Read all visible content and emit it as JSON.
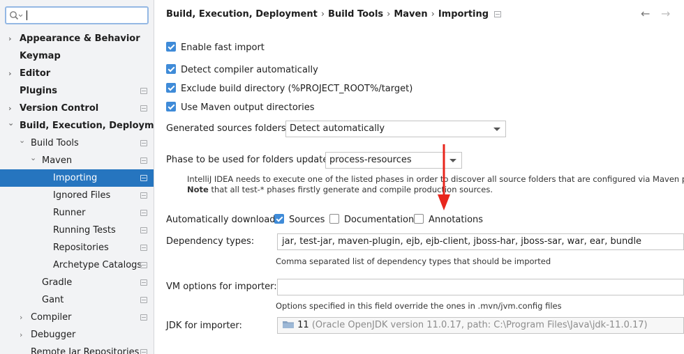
{
  "sidebar": {
    "items": [
      {
        "label": "Appearance & Behavior",
        "arrow": "collapsed",
        "bold": true,
        "project": false
      },
      {
        "label": "Keymap",
        "arrow": "none",
        "bold": true,
        "project": false
      },
      {
        "label": "Editor",
        "arrow": "collapsed",
        "bold": true,
        "project": false
      },
      {
        "label": "Plugins",
        "arrow": "none",
        "bold": true,
        "project": true
      },
      {
        "label": "Version Control",
        "arrow": "collapsed",
        "bold": true,
        "project": true
      },
      {
        "label": "Build, Execution, Deployment",
        "arrow": "expanded",
        "bold": true,
        "project": false
      },
      {
        "label": "Build Tools",
        "arrow": "expanded",
        "bold": false,
        "project": true
      },
      {
        "label": "Maven",
        "arrow": "expanded",
        "bold": false,
        "project": true
      },
      {
        "label": "Importing",
        "arrow": "none",
        "bold": false,
        "project": true,
        "selected": true
      },
      {
        "label": "Ignored Files",
        "arrow": "none",
        "bold": false,
        "project": true
      },
      {
        "label": "Runner",
        "arrow": "none",
        "bold": false,
        "project": true
      },
      {
        "label": "Running Tests",
        "arrow": "none",
        "bold": false,
        "project": true
      },
      {
        "label": "Repositories",
        "arrow": "none",
        "bold": false,
        "project": true
      },
      {
        "label": "Archetype Catalogs",
        "arrow": "none",
        "bold": false,
        "project": true
      },
      {
        "label": "Gradle",
        "arrow": "none",
        "bold": false,
        "project": true
      },
      {
        "label": "Gant",
        "arrow": "none",
        "bold": false,
        "project": true
      },
      {
        "label": "Compiler",
        "arrow": "collapsed",
        "bold": false,
        "project": true
      },
      {
        "label": "Debugger",
        "arrow": "collapsed",
        "bold": false,
        "project": false
      },
      {
        "label": "Remote Jar Repositories",
        "arrow": "none",
        "bold": false,
        "project": true
      }
    ]
  },
  "breadcrumb": {
    "parts": [
      "Build, Execution, Deployment",
      "Build Tools",
      "Maven",
      "Importing"
    ],
    "separator": "›"
  },
  "nav": {
    "back_icon": "arrow-left-icon",
    "forward_icon": "arrow-right-icon"
  },
  "options": {
    "enable_fast_import": {
      "label": "Enable fast import",
      "checked": true
    },
    "detect_compiler": {
      "label": "Detect compiler automatically",
      "checked": true
    },
    "exclude_build_dir": {
      "label": "Exclude build directory (%PROJECT_ROOT%/target)",
      "checked": true
    },
    "use_maven_output": {
      "label": "Use Maven output directories",
      "checked": true
    }
  },
  "generated_sources": {
    "label": "Generated sources folders:",
    "value": "Detect automatically"
  },
  "phase": {
    "label": "Phase to be used for folders update:",
    "value": "process-resources"
  },
  "phase_hint": {
    "line1": "IntelliJ IDEA needs to execute one of the listed phases in order to discover all source folders that are configured via Maven plugins.",
    "line2_bold": "Note",
    "line2": " that all test-* phases firstly generate and compile production sources."
  },
  "auto_download": {
    "label": "Automatically download:",
    "sources": {
      "label": "Sources",
      "checked": true
    },
    "documentation": {
      "label": "Documentation",
      "checked": false
    },
    "annotations": {
      "label": "Annotations",
      "checked": false
    }
  },
  "dependency_types": {
    "label": "Dependency types:",
    "value": "jar, test-jar, maven-plugin, ejb, ejb-client, jboss-har, jboss-sar, war, ear, bundle",
    "hint": "Comma separated list of dependency types that should be imported"
  },
  "vm_options": {
    "label": "VM options for importer:",
    "value": "",
    "hint": "Options specified in this field override the ones in .mvn/jvm.config files"
  },
  "jdk": {
    "label": "JDK for importer:",
    "version": "11",
    "detail": "(Oracle OpenJDK version 11.0.17, path: C:\\Program Files\\Java\\jdk-11.0.17)"
  },
  "colors": {
    "selection": "#2675bf",
    "checkbox": "#3f8bd8",
    "annotation_arrow": "#e8261d"
  }
}
